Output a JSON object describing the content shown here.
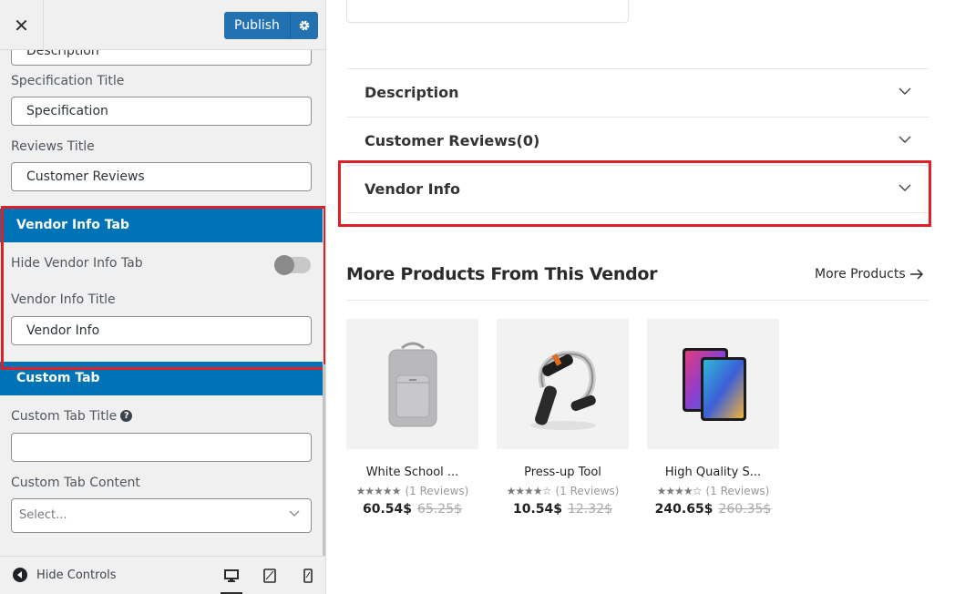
{
  "sidebar": {
    "close_icon": "close-icon",
    "publish_label": "Publish",
    "fields": {
      "description_value": "Description",
      "specification_label": "Specification Title",
      "specification_value": "Specification",
      "reviews_label": "Reviews Title",
      "reviews_value": "Customer Reviews"
    },
    "vendor_section": {
      "title": "Vendor Info Tab",
      "hide_label": "Hide Vendor Info Tab",
      "hide_enabled": false,
      "title_label": "Vendor Info Title",
      "title_value": "Vendor Info"
    },
    "custom_section": {
      "title": "Custom Tab",
      "tab_title_label": "Custom Tab Title",
      "tab_title_value": "",
      "content_label": "Custom Tab Content",
      "content_select_value": "Select..."
    },
    "footer": {
      "hide_controls_label": "Hide Controls",
      "devices": [
        "desktop-icon",
        "tablet-icon",
        "mobile-icon"
      ],
      "active_device": "desktop"
    }
  },
  "preview": {
    "accordion": [
      {
        "title": "Description"
      },
      {
        "title": "Customer Reviews(0)"
      },
      {
        "title": "Vendor Info"
      }
    ],
    "more_products": {
      "heading": "More Products From This Vendor",
      "link_label": "More Products"
    },
    "products": [
      {
        "name": "White School ...",
        "reviews": "(1 Reviews)",
        "price": "60.54$",
        "old_price": "65.25$",
        "stars": "★★★★★"
      },
      {
        "name": "Press-up Tool",
        "reviews": "(1 Reviews)",
        "price": "10.54$",
        "old_price": "12.32$",
        "stars": "★★★★☆"
      },
      {
        "name": "High Quality S...",
        "reviews": "(1 Reviews)",
        "price": "240.65$",
        "old_price": "260.35$",
        "stars": "★★★★☆"
      }
    ]
  },
  "colors": {
    "accent": "#0073b7",
    "publish": "#2271b1",
    "highlight": "#dd2128"
  }
}
